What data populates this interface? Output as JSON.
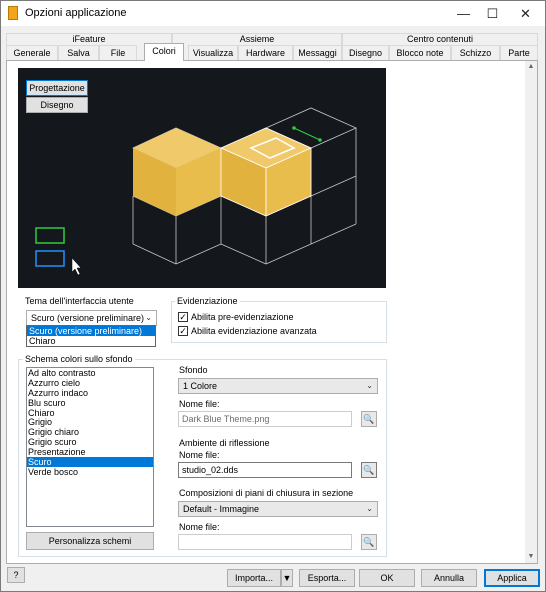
{
  "window": {
    "title": "Opzioni applicazione",
    "icon": "inventor-app-icon"
  },
  "tabs_top": [
    "iFeature",
    "Assieme",
    "Centro contenuti"
  ],
  "tabs": [
    "Generale",
    "Salva",
    "File",
    "Colori",
    "Visualizza",
    "Hardware",
    "Messaggi",
    "Disegno",
    "Blocco note",
    "Schizzo",
    "Parte"
  ],
  "active_tab": "Colori",
  "preview": {
    "buttons": [
      "Progettazione",
      "Disegno"
    ],
    "selected": "Progettazione"
  },
  "theme": {
    "label": "Tema dell'interfaccia utente",
    "value": "Scuro (versione preliminare)",
    "options": [
      "Scuro (versione preliminare)",
      "Chiaro"
    ]
  },
  "highlight": {
    "label": "Evidenziazione",
    "pre_label": "Abilita pre-evidenziazione",
    "pre_checked": true,
    "adv_label": "Abilita evidenziazione avanzata",
    "adv_checked": true
  },
  "scheme": {
    "label": "Schema colori sullo sfondo",
    "items": [
      "Ad alto contrasto",
      "Azzurro cielo",
      "Azzurro indaco",
      "Blu scuro",
      "Chiaro",
      "Grigio",
      "Grigio chiaro",
      "Grigio scuro",
      "Presentazione",
      "Scuro",
      "Verde bosco"
    ],
    "selected": "Scuro",
    "customize_label": "Personalizza schemi"
  },
  "background": {
    "label": "Sfondo",
    "value": "1 Colore",
    "file_label": "Nome file:",
    "file_value": "Dark Blue Theme.png"
  },
  "reflection": {
    "label": "Ambiente di riflessione",
    "file_label": "Nome file:",
    "file_value": "studio_02.dds"
  },
  "section": {
    "label": "Composizioni di piani di chiusura in sezione",
    "value": "Default - Immagine",
    "file_label": "Nome file:",
    "file_value": ""
  },
  "footer": {
    "help": "?",
    "import": "Importa...",
    "export": "Esporta...",
    "ok": "OK",
    "cancel": "Annulla",
    "apply": "Applica"
  },
  "colors": {
    "accent": "#0078d7",
    "cube": "#e8bd4b",
    "preview_bg": "#14171b"
  }
}
